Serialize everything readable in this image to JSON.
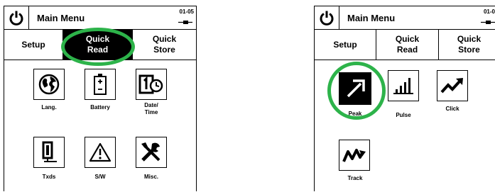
{
  "left": {
    "header": {
      "title": "Main Menu",
      "code": "01-05"
    },
    "tabs": [
      {
        "label_line1": "Setup",
        "label_line2": ""
      },
      {
        "label_line1": "Quick",
        "label_line2": "Read"
      },
      {
        "label_line1": "Quick",
        "label_line2": "Store"
      }
    ],
    "tiles": [
      {
        "label_line1": "Lang.",
        "label_line2": "",
        "icon": "globe-icon"
      },
      {
        "label_line1": "Battery",
        "label_line2": "",
        "icon": "battery-icon"
      },
      {
        "label_line1": "Date/",
        "label_line2": "Time",
        "icon": "date-time-icon"
      },
      {
        "label_line1": "Txds",
        "label_line2": "",
        "icon": "transducer-icon"
      },
      {
        "label_line1": "S/W",
        "label_line2": "",
        "icon": "warning-icon"
      },
      {
        "label_line1": "Misc.",
        "label_line2": "",
        "icon": "tools-icon"
      }
    ]
  },
  "right": {
    "header": {
      "title": "Main Menu",
      "code": "01-0"
    },
    "tabs": [
      {
        "label_line1": "Setup",
        "label_line2": ""
      },
      {
        "label_line1": "Quick",
        "label_line2": "Read"
      },
      {
        "label_line1": "Quick",
        "label_line2": "Store"
      }
    ],
    "tiles": [
      {
        "label_line1": "Peak",
        "label_line2": "",
        "icon": "peak-arrow-icon"
      },
      {
        "label_line1": "Pulse",
        "label_line2": "",
        "icon": "pulse-bars-icon"
      },
      {
        "label_line1": "Click",
        "label_line2": "",
        "icon": "click-trend-icon"
      },
      {
        "label_line1": "Track",
        "label_line2": "",
        "icon": "track-wave-icon"
      }
    ]
  },
  "colors": {
    "highlight": "#2db34a",
    "active_tab": "#000000",
    "background": "#ffffff"
  }
}
